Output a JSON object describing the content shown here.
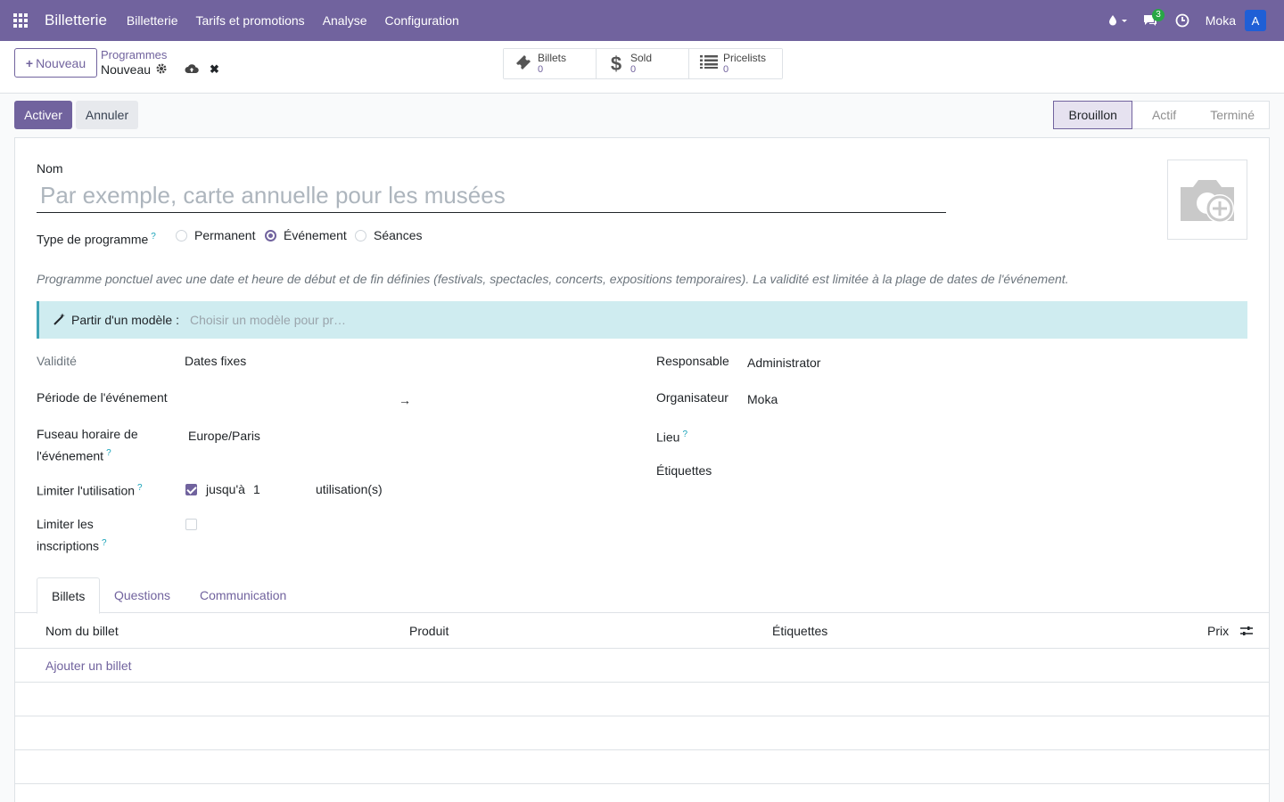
{
  "nav": {
    "brand": "Billetterie",
    "items": [
      "Billetterie",
      "Tarifs et promotions",
      "Analyse",
      "Configuration"
    ],
    "messages_badge": "3",
    "user": "Moka",
    "avatar_letter": "A",
    "bar_color": "#71639e"
  },
  "control_panel": {
    "new_label": "Nouveau",
    "breadcrumb": "Programmes",
    "record": "Nouveau",
    "smart_buttons": [
      {
        "label": "Billets",
        "count": "0",
        "icon": "ticket-icon"
      },
      {
        "label": "Sold",
        "count": "0",
        "icon": "dollar-icon"
      },
      {
        "label": "Pricelists",
        "count": "0",
        "icon": "list-icon"
      }
    ]
  },
  "statusbar": {
    "activate": "Activer",
    "cancel": "Annuler",
    "stages": [
      "Brouillon",
      "Actif",
      "Terminé"
    ],
    "active_stage": "Brouillon"
  },
  "form": {
    "name_label": "Nom",
    "name_placeholder": "Par exemple, carte annuelle pour les musées",
    "type_label": "Type de programme",
    "type_options": [
      "Permanent",
      "Événement",
      "Séances"
    ],
    "type_selected": "Événement",
    "description": "Programme ponctuel avec une date et heure de début et de fin définies (festivals, spectacles, concerts, expositions temporaires). La validité est limitée à la plage de dates de l'événement.",
    "template_label": "Partir d'un modèle :",
    "template_placeholder": "Choisir un modèle pour pr…",
    "validity_label": "Validité",
    "validity_value": "Dates fixes",
    "period_label": "Période de l'événement",
    "period_arrow": "→",
    "timezone_label_1": "Fuseau horaire de",
    "timezone_label_2": "l'événement",
    "timezone_value": "Europe/Paris",
    "limit_usage_label": "Limiter l'utilisation",
    "limit_usage_prefix": "jusqu'à",
    "limit_usage_value": "1",
    "limit_usage_suffix": "utilisation(s)",
    "limit_reg_label_1": "Limiter les",
    "limit_reg_label_2": "inscriptions",
    "responsible_label": "Responsable",
    "responsible_value": "Administrator",
    "organizer_label": "Organisateur",
    "organizer_value": "Moka",
    "place_label": "Lieu",
    "tags_label": "Étiquettes",
    "help_mark": "?"
  },
  "tabs": [
    "Billets",
    "Questions",
    "Communication"
  ],
  "table": {
    "columns": [
      "Nom du billet",
      "Produit",
      "Étiquettes",
      "Prix"
    ],
    "add_line": "Ajouter un billet"
  }
}
